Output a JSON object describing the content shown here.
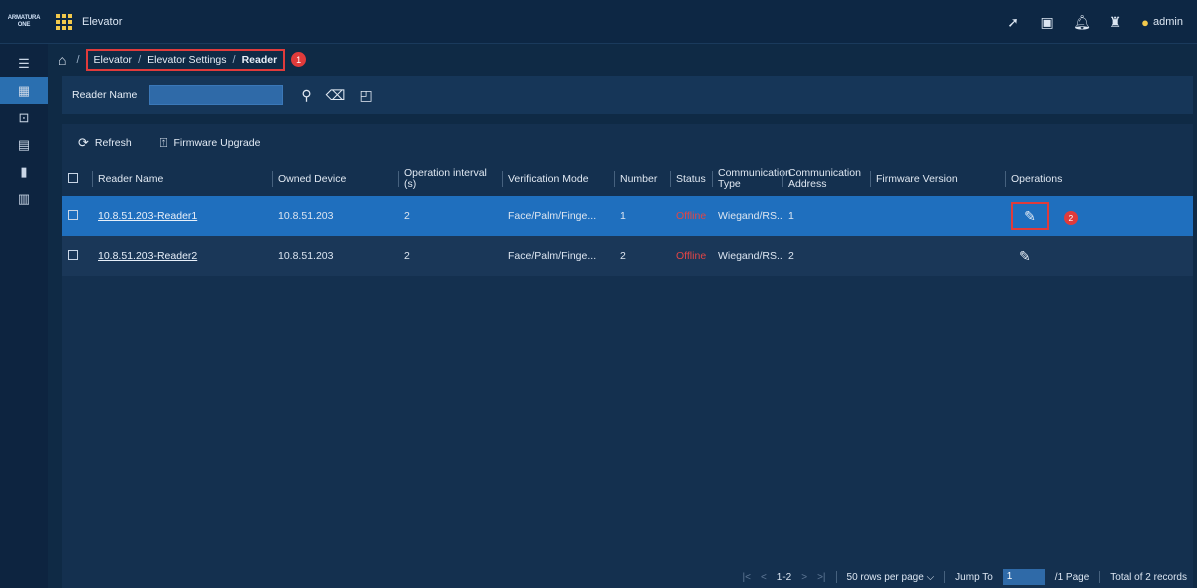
{
  "header": {
    "logo_line1": "ARMATURA",
    "logo_line2": "ONE",
    "app_title": "Elevator",
    "user": "admin"
  },
  "breadcrumb": {
    "items": [
      "Elevator",
      "Elevator Settings",
      "Reader"
    ],
    "badge": "1"
  },
  "search": {
    "label": "Reader Name",
    "value": ""
  },
  "toolbar": {
    "refresh": "Refresh",
    "firmware_upgrade": "Firmware Upgrade"
  },
  "table": {
    "columns": [
      "Reader Name",
      "Owned Device",
      "Operation interval (s)",
      "Verification Mode",
      "Number",
      "Status",
      "Communication Type",
      "Communication Address",
      "Firmware Version",
      "Operations"
    ],
    "rows": [
      {
        "name": "10.8.51.203-Reader1",
        "device": "10.8.51.203",
        "interval": "2",
        "mode": "Face/Palm/Finge...",
        "number": "1",
        "status": "Offline",
        "comm_type": "Wiegand/RS...",
        "comm_addr": "1",
        "firmware": ""
      },
      {
        "name": "10.8.51.203-Reader2",
        "device": "10.8.51.203",
        "interval": "2",
        "mode": "Face/Palm/Finge...",
        "number": "2",
        "status": "Offline",
        "comm_type": "Wiegand/RS...",
        "comm_addr": "2",
        "firmware": ""
      }
    ],
    "op_badge": "2"
  },
  "pagination": {
    "range": "1-2",
    "rows_per_page": "50 rows per page",
    "jump_label": "Jump To",
    "jump_value": "1",
    "pages": "/1 Page",
    "total": "Total of 2 records"
  }
}
